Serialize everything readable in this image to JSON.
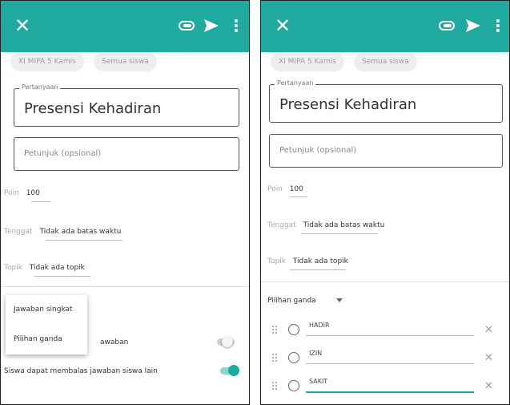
{
  "header": {
    "close_icon": "close-icon",
    "attach_icon": "attach-icon",
    "send_icon": "send-icon",
    "more_icon": "more-vert-icon",
    "bar_color": "#1fa99f"
  },
  "chips": {
    "class_label": "XI MIPA 5   Kamis",
    "students_label": "Semua siswa"
  },
  "question": {
    "legend": "Pertanyaan",
    "value": "Presensi Kehadiran"
  },
  "instructions": {
    "placeholder": "Petunjuk (opsional)"
  },
  "points": {
    "label": "Poin",
    "value": "100"
  },
  "due": {
    "label": "Tenggat",
    "value": "Tidak ada batas waktu"
  },
  "topic": {
    "label": "Topik",
    "value": "Tidak ada topik"
  },
  "type_menu": {
    "items": [
      "Jawaban singkat",
      "Pilihan ganda"
    ]
  },
  "toggles": {
    "edit_answer_partial": "awaban",
    "reply_label": "Siswa dapat membalas jawaban siswa lain",
    "reply_on": true,
    "edit_on": false,
    "accent": "#1fa99f"
  },
  "question_type": {
    "selected": "Pilihan ganda"
  },
  "options": [
    {
      "text": "HADIR"
    },
    {
      "text": "IZIN"
    },
    {
      "text": "SAKIT"
    }
  ]
}
